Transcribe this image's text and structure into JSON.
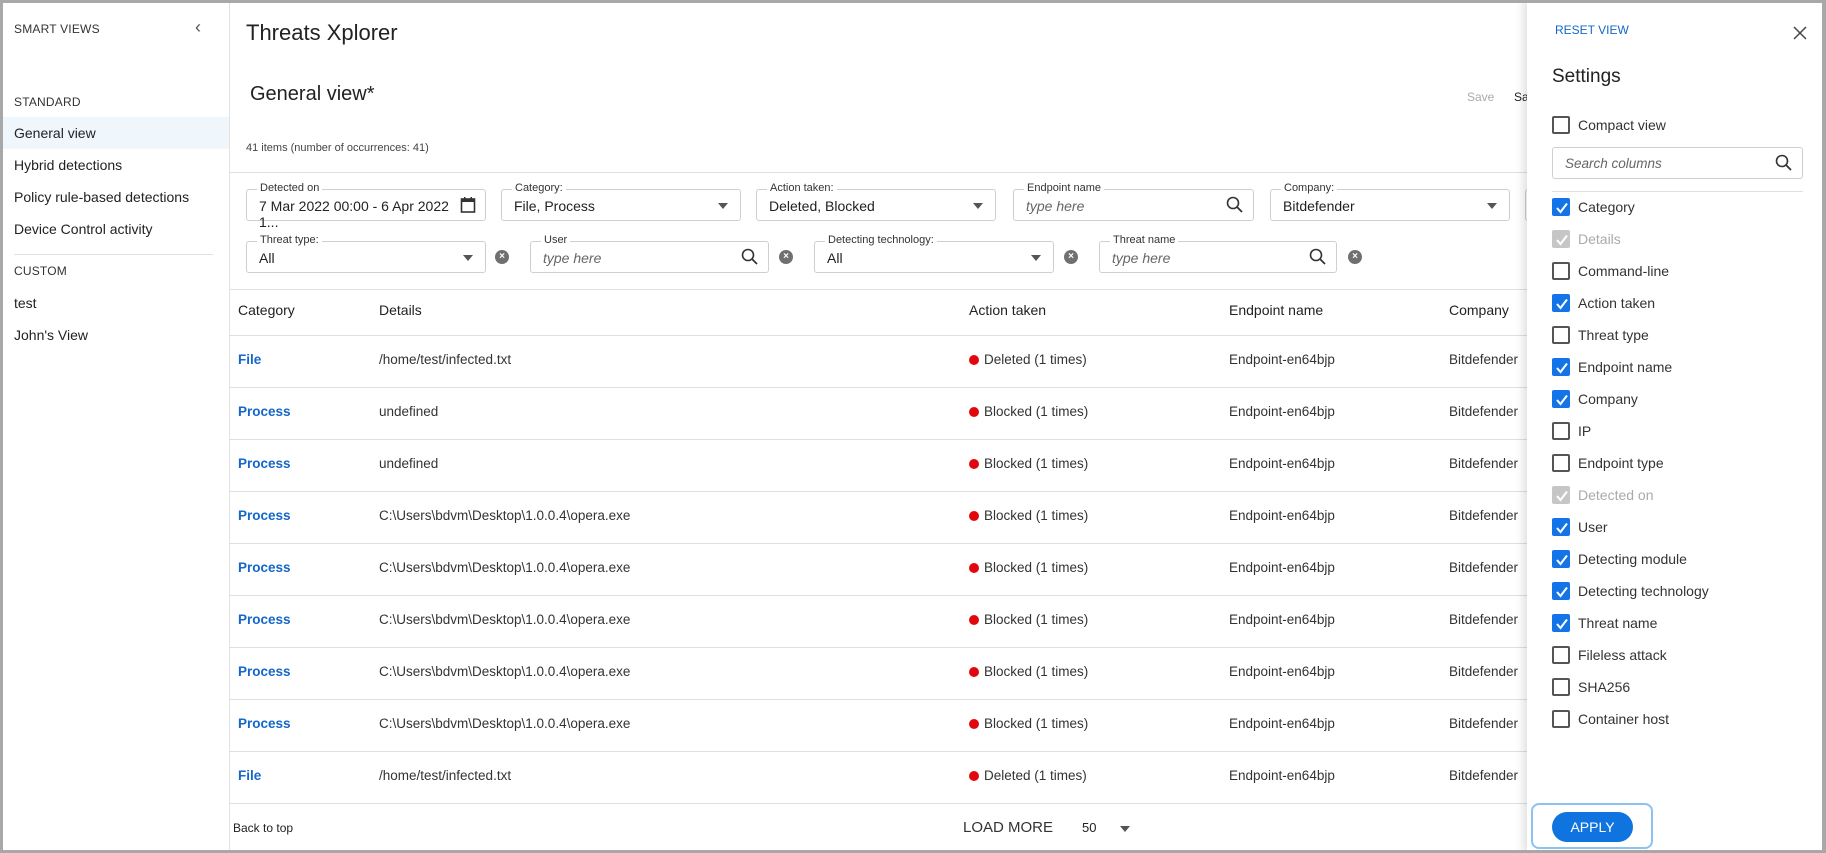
{
  "sidebar": {
    "title": "SMART VIEWS",
    "standard_label": "STANDARD",
    "standard": [
      {
        "label": "General view",
        "active": true
      },
      {
        "label": "Hybrid detections"
      },
      {
        "label": "Policy rule-based detections"
      },
      {
        "label": "Device Control activity"
      }
    ],
    "custom_label": "CUSTOM",
    "custom": [
      {
        "label": "test"
      },
      {
        "label": "John's View"
      }
    ]
  },
  "header": {
    "app_title": "Threats Xplorer",
    "view_title": "General view*",
    "save_label": "Save",
    "save_as_label": "Sa",
    "items_count": "41 items (number of occurrences: 41)"
  },
  "filters": {
    "detected_on": {
      "label": "Detected on",
      "value": "7 Mar 2022 00:00 - 6 Apr 2022 1..."
    },
    "category": {
      "label": "Category:",
      "value": "File, Process"
    },
    "action_taken": {
      "label": "Action taken:",
      "value": "Deleted, Blocked"
    },
    "endpoint_name": {
      "label": "Endpoint name",
      "placeholder": "type here"
    },
    "company": {
      "label": "Company:",
      "value": "Bitdefender"
    },
    "threat_type": {
      "label": "Threat type:",
      "value": "All"
    },
    "user": {
      "label": "User",
      "placeholder": "type here"
    },
    "detecting_technology": {
      "label": "Detecting technology:",
      "value": "All"
    },
    "threat_name": {
      "label": "Threat name",
      "placeholder": "type here"
    }
  },
  "table": {
    "columns": [
      "Category",
      "Details",
      "Action taken",
      "Endpoint name",
      "Company"
    ],
    "rows": [
      [
        "File",
        "/home/test/infected.txt",
        "Deleted (1 times)",
        "Endpoint-en64bjp",
        "Bitdefender"
      ],
      [
        "Process",
        "undefined",
        "Blocked (1 times)",
        "Endpoint-en64bjp",
        "Bitdefender"
      ],
      [
        "Process",
        "undefined",
        "Blocked (1 times)",
        "Endpoint-en64bjp",
        "Bitdefender"
      ],
      [
        "Process",
        "C:\\Users\\bdvm\\Desktop\\1.0.0.4\\opera.exe",
        "Blocked (1 times)",
        "Endpoint-en64bjp",
        "Bitdefender"
      ],
      [
        "Process",
        "C:\\Users\\bdvm\\Desktop\\1.0.0.4\\opera.exe",
        "Blocked (1 times)",
        "Endpoint-en64bjp",
        "Bitdefender"
      ],
      [
        "Process",
        "C:\\Users\\bdvm\\Desktop\\1.0.0.4\\opera.exe",
        "Blocked (1 times)",
        "Endpoint-en64bjp",
        "Bitdefender"
      ],
      [
        "Process",
        "C:\\Users\\bdvm\\Desktop\\1.0.0.4\\opera.exe",
        "Blocked (1 times)",
        "Endpoint-en64bjp",
        "Bitdefender"
      ],
      [
        "Process",
        "C:\\Users\\bdvm\\Desktop\\1.0.0.4\\opera.exe",
        "Blocked (1 times)",
        "Endpoint-en64bjp",
        "Bitdefender"
      ],
      [
        "File",
        "/home/test/infected.txt",
        "Deleted (1 times)",
        "Endpoint-en64bjp",
        "Bitdefender"
      ]
    ]
  },
  "footer": {
    "back_to_top": "Back to top",
    "load_more": "LOAD MORE",
    "page_size": "50"
  },
  "settings": {
    "reset_label": "RESET VIEW",
    "title": "Settings",
    "compact_view": "Compact view",
    "search_placeholder": "Search columns",
    "apply_label": "APPLY",
    "columns": [
      {
        "label": "Category",
        "checked": true
      },
      {
        "label": "Details",
        "checked": true,
        "disabled": true
      },
      {
        "label": "Command-line",
        "checked": false
      },
      {
        "label": "Action taken",
        "checked": true
      },
      {
        "label": "Threat type",
        "checked": false
      },
      {
        "label": "Endpoint name",
        "checked": true
      },
      {
        "label": "Company",
        "checked": true
      },
      {
        "label": "IP",
        "checked": false
      },
      {
        "label": "Endpoint type",
        "checked": false
      },
      {
        "label": "Detected on",
        "checked": true,
        "disabled": true
      },
      {
        "label": "User",
        "checked": true
      },
      {
        "label": "Detecting module",
        "checked": true
      },
      {
        "label": "Detecting technology",
        "checked": true
      },
      {
        "label": "Threat name",
        "checked": true
      },
      {
        "label": "Fileless attack",
        "checked": false
      },
      {
        "label": "SHA256",
        "checked": false
      },
      {
        "label": "Container host",
        "checked": false
      }
    ]
  },
  "colors": {
    "accent": "#1473e6",
    "link": "#1467c8",
    "status_red": "#e0080d",
    "active_bg": "#f0f7fc"
  }
}
